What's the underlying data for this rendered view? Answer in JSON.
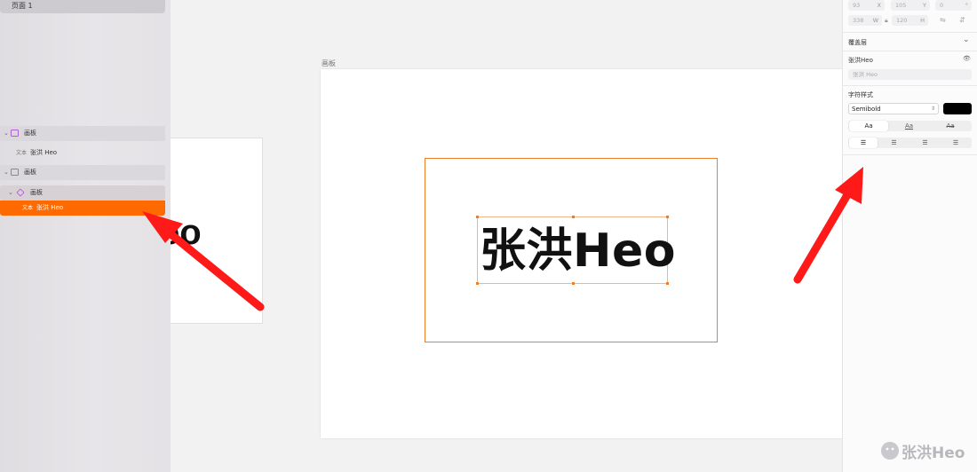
{
  "sidebar": {
    "page_label": "页面 1",
    "layers": [
      {
        "label": "画板",
        "tag": ""
      },
      {
        "label": "张洪 Heo",
        "tag": "文本"
      },
      {
        "label": "画板",
        "tag": ""
      },
      {
        "label": "画板",
        "tag": ""
      },
      {
        "label": "张洪 Heo",
        "tag": "文本"
      }
    ]
  },
  "canvas": {
    "left_card_text": "eo",
    "artboard_label": "画板",
    "text_content": "张洪Heo"
  },
  "inspector": {
    "x_value": "93",
    "x_suffix": "X",
    "y_value": "105",
    "y_suffix": "Y",
    "rot_value": "0",
    "rot_suffix": "°",
    "w_value": "338",
    "w_suffix": "W",
    "h_value": "120",
    "h_suffix": "H",
    "overlay_title": "覆盖层",
    "layer_name": "张洪Heo",
    "layer_placeholder": "张洪 Heo",
    "char_style_title": "字符样式",
    "font_weight": "Semibold",
    "font_color": "#000000",
    "case_options": [
      "Aa",
      "Aa",
      "Aa"
    ],
    "align_options": [
      "left",
      "center",
      "right",
      "justify"
    ]
  },
  "colors": {
    "accent": "#ff6a00",
    "selection": "#f07d2a",
    "arrow": "#ff1a1a"
  },
  "watermark": {
    "text": "张洪Heo"
  }
}
